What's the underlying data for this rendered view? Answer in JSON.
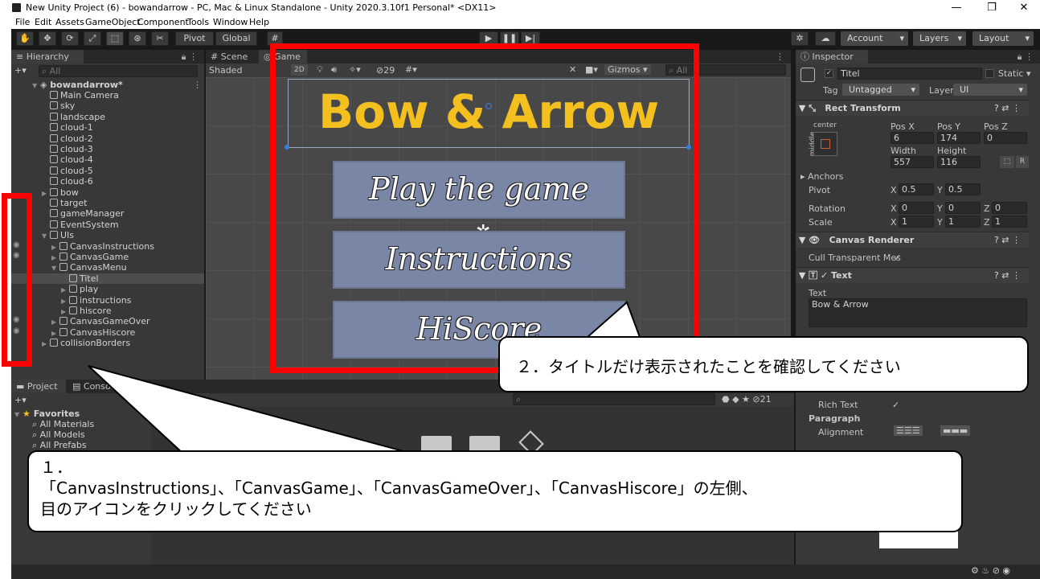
{
  "window": {
    "title": "New Unity Project (6) - bowandarrow - PC, Mac & Linux Standalone - Unity 2020.3.10f1 Personal* <DX11>",
    "minimize": "—",
    "maximize": "❐",
    "close": "✕"
  },
  "menu": [
    "File",
    "Edit",
    "Assets",
    "GameObject",
    "Component",
    "Tools",
    "Window",
    "Help"
  ],
  "toolbar": {
    "pivot": "Pivot",
    "global": "Global",
    "account": "Account",
    "layers": "Layers",
    "layout": "Layout"
  },
  "hierarchy": {
    "tab": "Hierarchy",
    "search_placeholder": "All",
    "scene": "bowandarrow*",
    "items": [
      {
        "label": "Main Camera",
        "depth": 2
      },
      {
        "label": "sky",
        "depth": 2
      },
      {
        "label": "landscape",
        "depth": 2
      },
      {
        "label": "cloud-1",
        "depth": 2
      },
      {
        "label": "cloud-2",
        "depth": 2
      },
      {
        "label": "cloud-3",
        "depth": 2
      },
      {
        "label": "cloud-4",
        "depth": 2
      },
      {
        "label": "cloud-5",
        "depth": 2
      },
      {
        "label": "cloud-6",
        "depth": 2
      },
      {
        "label": "bow",
        "depth": 2
      },
      {
        "label": "target",
        "depth": 2
      },
      {
        "label": "gameManager",
        "depth": 2
      },
      {
        "label": "EventSystem",
        "depth": 2
      },
      {
        "label": "UIs",
        "depth": 2
      },
      {
        "label": "CanvasInstructions",
        "depth": 3
      },
      {
        "label": "CanvasGame",
        "depth": 3
      },
      {
        "label": "CanvasMenu",
        "depth": 3
      },
      {
        "label": "Titel",
        "depth": 4
      },
      {
        "label": "play",
        "depth": 4
      },
      {
        "label": "instructions",
        "depth": 4
      },
      {
        "label": "hiscore",
        "depth": 4
      },
      {
        "label": "CanvasGameOver",
        "depth": 3
      },
      {
        "label": "CanvasHiscore",
        "depth": 3
      },
      {
        "label": "collisionBorders",
        "depth": 2
      }
    ]
  },
  "scene_tabs": {
    "scene": "Scene",
    "game": "Game",
    "shaded": "Shaded",
    "two_d": "2D",
    "hidden_count": "29",
    "gizmos": "Gizmos",
    "search_placeholder": "All"
  },
  "game_view": {
    "title": "Bow & Arrow",
    "buttons": [
      "Play the game",
      "Instructions",
      "HiScore"
    ],
    "separator": "✲"
  },
  "project": {
    "tab_project": "Project",
    "tab_console": "Console",
    "favorites": "Favorites",
    "fav_items": [
      "All Materials",
      "All Models",
      "All Prefabs"
    ],
    "count": "21"
  },
  "inspector": {
    "tab": "Inspector",
    "object_name": "Titel",
    "static": "Static",
    "tag_label": "Tag",
    "tag_value": "Untagged",
    "layer_label": "Layer",
    "layer_value": "UI",
    "rect_transform": "Rect Transform",
    "anchor_h": "center",
    "anchor_v": "middle",
    "pos_x_label": "Pos X",
    "pos_y_label": "Pos Y",
    "pos_z_label": "Pos Z",
    "pos_x": "6",
    "pos_y": "174",
    "pos_z": "0",
    "width_label": "Width",
    "height_label": "Height",
    "width": "557",
    "height": "116",
    "r_btn": "R",
    "anchors": "Anchors",
    "pivot": "Pivot",
    "pivot_x": "0.5",
    "pivot_y": "0.5",
    "rotation": "Rotation",
    "rot_x": "0",
    "rot_y": "0",
    "rot_z": "0",
    "scale": "Scale",
    "scale_x": "1",
    "scale_y": "1",
    "scale_z": "1",
    "x": "X",
    "y": "Y",
    "z": "Z",
    "canvas_renderer": "Canvas Renderer",
    "cull": "Cull Transparent Mes",
    "text_comp": "Text",
    "text_label": "Text",
    "text_value": "Bow & Arrow",
    "rich_text": "Rich Text",
    "paragraph": "Paragraph",
    "alignment": "Alignment"
  },
  "callouts": {
    "step1_num": "１．",
    "step1_line1": "「CanvasInstructions」、「CanvasGame」、「CanvasGameOver」、「CanvasHiscore」の左側、",
    "step1_line2": "目のアイコンをクリックしてください",
    "step2": "２．タイトルだけ表示されたことを確認してください"
  },
  "colors": {
    "annotation_red": "#ff0000",
    "title_yellow": "#f4c020",
    "button_fill": "#7a86a6"
  }
}
